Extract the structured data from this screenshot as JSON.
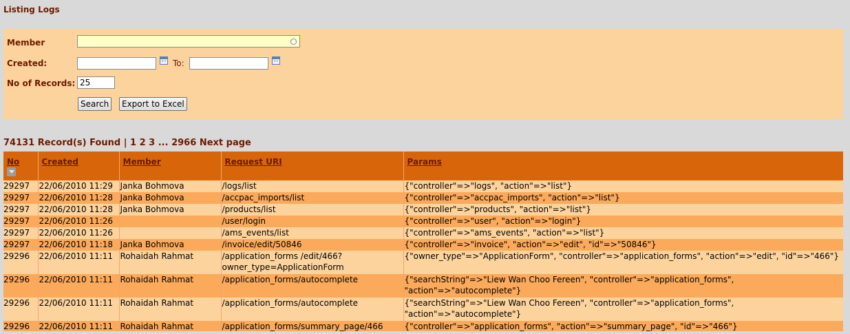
{
  "page": {
    "title": "Listing Logs"
  },
  "filters": {
    "member_label": "Member",
    "member_value": "",
    "created_label": "Created:",
    "created_from": "",
    "to_label": "To:",
    "created_to": "",
    "records_label": "No of Records:",
    "records_value": "25",
    "search_button": "Search",
    "export_button": "Export to Excel"
  },
  "pager": {
    "count_text": "74131 Record(s) Found",
    "separator": "|",
    "pages": [
      "1",
      "2",
      "3"
    ],
    "ellipsis": "...",
    "last_page": "2966",
    "next": "Next page"
  },
  "table": {
    "columns": [
      "No",
      "Created",
      "Member",
      "Request URI",
      "Params"
    ],
    "rows": [
      {
        "no": "29297",
        "created": "22/06/2010 11:29",
        "member": "Janka Bohmova",
        "uri": "/logs/list",
        "params": "{\"controller\"=>\"logs\", \"action\"=>\"list\"}"
      },
      {
        "no": "29297",
        "created": "22/06/2010 11:28",
        "member": "Janka Bohmova",
        "uri": "/accpac_imports/list",
        "params": "{\"controller\"=>\"accpac_imports\", \"action\"=>\"list\"}"
      },
      {
        "no": "29297",
        "created": "22/06/2010 11:28",
        "member": "Janka Bohmova",
        "uri": "/products/list",
        "params": "{\"controller\"=>\"products\", \"action\"=>\"list\"}"
      },
      {
        "no": "29297",
        "created": "22/06/2010 11:26",
        "member": "",
        "uri": "/user/login",
        "params": "{\"controller\"=>\"user\", \"action\"=>\"login\"}"
      },
      {
        "no": "29297",
        "created": "22/06/2010 11:26",
        "member": "",
        "uri": "/ams_events/list",
        "params": "{\"controller\"=>\"ams_events\", \"action\"=>\"list\"}"
      },
      {
        "no": "29297",
        "created": "22/06/2010 11:18",
        "member": "Janka Bohmova",
        "uri": "/invoice/edit/50846",
        "params": "{\"controller\"=>\"invoice\", \"action\"=>\"edit\", \"id\"=>\"50846\"}"
      },
      {
        "no": "29296",
        "created": "22/06/2010 11:11",
        "member": "Rohaidah Rahmat",
        "uri": "/application_forms /edit/466?owner_type=ApplicationForm",
        "params": "{\"owner_type\"=>\"ApplicationForm\", \"controller\"=>\"application_forms\", \"action\"=>\"edit\", \"id\"=>\"466\"}"
      },
      {
        "no": "29296",
        "created": "22/06/2010 11:11",
        "member": "Rohaidah Rahmat",
        "uri": "/application_forms/autocomplete",
        "params": "{\"searchString\"=>\"Liew Wan Choo Fereen\", \"controller\"=>\"application_forms\", \"action\"=>\"autocomplete\"}"
      },
      {
        "no": "29296",
        "created": "22/06/2010 11:11",
        "member": "Rohaidah Rahmat",
        "uri": "/application_forms/autocomplete",
        "params": "{\"searchString\"=>\"Liew Wan Choo Fereen\", \"controller\"=>\"application_forms\", \"action\"=>\"autocomplete\"}"
      },
      {
        "no": "29296",
        "created": "22/06/2010 11:11",
        "member": "Rohaidah Rahmat",
        "uri": "/application_forms/summary_page/466",
        "params": "{\"controller\"=>\"application_forms\", \"action\"=>\"summary_page\", \"id\"=>\"466\"}"
      }
    ]
  }
}
